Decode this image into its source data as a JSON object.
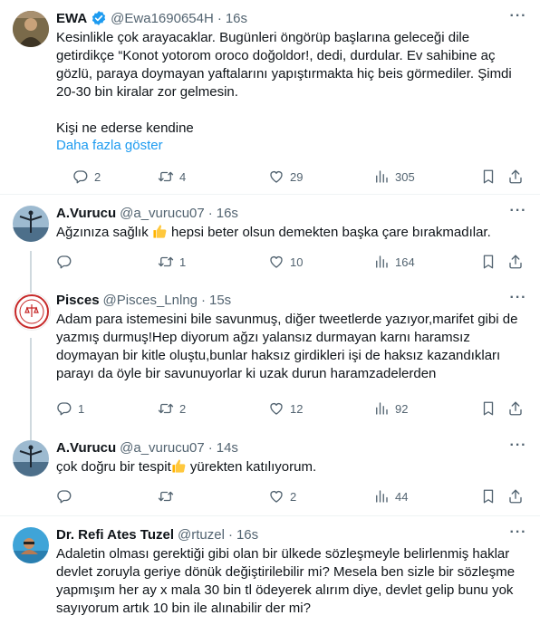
{
  "colors": {
    "link": "#1d9bf0",
    "muted": "#536471",
    "text": "#0f1419",
    "verified": "#1d9bf0",
    "thread_line": "#cfd9de"
  },
  "tweets": [
    {
      "name": "EWA",
      "handle": "@Ewa1690654H",
      "time": "16s",
      "verified": true,
      "avatar_icon": "user-avatar-photo",
      "text": "Kesinlikle çok arayacaklar. Bugünleri öngörüp başlarına geleceği dile getirdikçe “Konot yotorom oroco doğoldor!, dedi, durdular. Ev sahibine aç gözlü, paraya doymayan yaftalarını yapıştırmakta hiç beis görmediler. Şimdi 20-30 bin kiralar zor gelmesin.\n\nKişi ne ederse kendine",
      "show_more": "Daha fazla göster",
      "replies": "2",
      "retweets": "4",
      "likes": "29",
      "views": "305"
    },
    {
      "name": "A.Vurucu",
      "handle": "@a_vurucu07",
      "time": "16s",
      "avatar_icon": "user-avatar-photo",
      "text_before": "Ağzınıza sağlık ",
      "text_after": " hepsi beter olsun demekten başka çare bırakmadılar.",
      "emoji": "thumbs-up-icon",
      "replies": "",
      "retweets": "1",
      "likes": "10",
      "views": "164"
    },
    {
      "name": "Pisces",
      "handle": "@Pisces_Lnlng",
      "time": "15s",
      "avatar_icon": "seal-avatar",
      "text": "Adam para istemesini bile savunmuş, diğer tweetlerde yazıyor,marifet gibi de yazmış durmuş!Hep diyorum ağzı yalansız durmayan karnı haramsız doymayan bir kitle oluştu,bunlar haksız girdikleri işi de haksız kazandıkları parayı da öyle bir savunuyorlar ki uzak durun haramzadelerden",
      "replies": "1",
      "retweets": "2",
      "likes": "12",
      "views": "92"
    },
    {
      "name": "A.Vurucu",
      "handle": "@a_vurucu07",
      "time": "14s",
      "avatar_icon": "user-avatar-photo",
      "text_before": "çok doğru bir tespit",
      "text_after": " yürekten katılıyorum.",
      "emoji": "thumbs-up-icon",
      "replies": "",
      "retweets": "",
      "likes": "2",
      "views": "44"
    },
    {
      "name": "Dr. Refi Ates Tuzel",
      "handle": "@rtuzel",
      "time": "16s",
      "avatar_icon": "user-avatar-photo",
      "text": "Adaletin olması gerektiği gibi olan bir ülkede sözleşmeyle belirlenmiş haklar devlet zoruyla geriye dönük değiştirilebilir mi? Mesela ben sizle bir sözleşme yapmışım her ay x mala 30 bin tl ödeyerek alırım diye, devlet gelip bunu yok sayıyorum artık 10 bin ile alınabilir der mi?"
    }
  ]
}
